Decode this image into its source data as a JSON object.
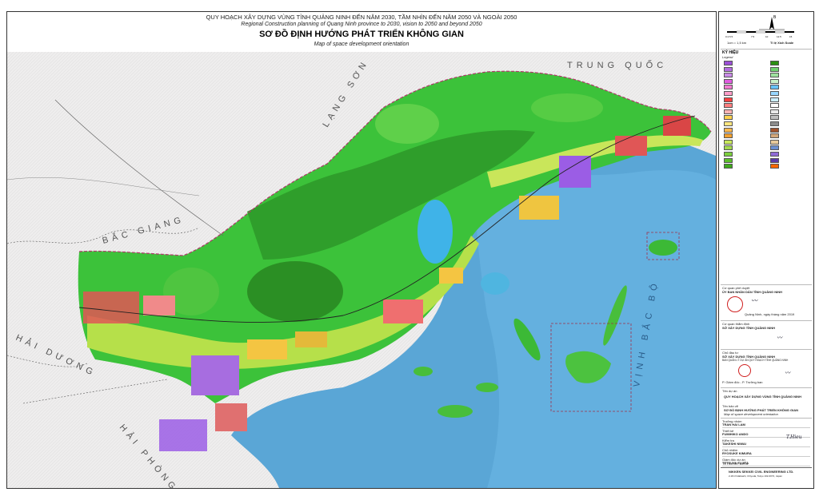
{
  "title": {
    "vn_line1": "QUY HOẠCH XÂY DỰNG VÙNG TỈNH QUẢNG NINH ĐẾN NĂM 2030, TẦM NHÌN ĐẾN NĂM 2050 VÀ NGOÀI 2050",
    "en_line1": "Regional Construction planning of Quang Ninh province to 2030, vision to 2050 and beyond 2050",
    "vn_main": "SƠ ĐỒ ĐỊNH HƯỚNG PHÁT TRIỂN KHÔNG GIAN",
    "en_main": "Map of space development orientation"
  },
  "map_labels": {
    "lang_son": "LẠNG SƠN",
    "trung_quoc": "TRUNG QUỐC",
    "bac_giang": "BẮC GIANG",
    "hai_duong": "HẢI DƯƠNG",
    "hai_phong": "HẢI PHÒNG",
    "vinh_bac_bo": "VỊNH BẮC BỘ"
  },
  "scale": {
    "ticks": [
      "0 2.5 5",
      "7.5",
      "10",
      "12.5",
      "15"
    ],
    "unit": "1cm = 1,5 km",
    "scale_text": "Tỉ lệ Xích Scale"
  },
  "legend": {
    "title_vn": "KÝ HIỆU",
    "title_en": "Legend",
    "colors": [
      "#9b4fd6",
      "#b46ce0",
      "#c98ae7",
      "#e05de0",
      "#f07bd0",
      "#ff9ec9",
      "#ff4040",
      "#ff7f7f",
      "#ffb3b3",
      "#ffd24d",
      "#ffe680",
      "#ffb84d",
      "#f0a030",
      "#c8e85c",
      "#a4d850",
      "#7ccf3e",
      "#5cbf2a",
      "#3fa81c",
      "#2b8f12",
      "#70d070",
      "#9fe09f",
      "#c8f0c8",
      "#66c2ff",
      "#99d6ff",
      "#cceeff",
      "#ffffff",
      "#e8e8e8",
      "#bdbdbd",
      "#8c8c8c",
      "#a0522d",
      "#d2a679",
      "#e6c99a",
      "#6a8fd0",
      "#8f6bd6",
      "#5a3aa8",
      "#ff6600"
    ]
  },
  "approval": {
    "head1": "Cơ quan phê duyệt",
    "org1": "ỦY BAN NHÂN DÂN TỈNH QUẢNG NINH",
    "date1": "Quảng Ninh, ngày   tháng   năm 2019",
    "head2": "Cơ quan thẩm định",
    "org2": "SỞ XÂY DỰNG TỈNH QUẢNG NINH",
    "head3": "Chủ đầu tư",
    "org3": "SỞ XÂY DỰNG TỈNH QUẢNG NINH",
    "sub3": "BAN QUẢN LÝ DỰ ÁN QUY HOẠCH TỈNH QUẢNG NINH",
    "role3": "P. Giám đốc - P. Trưởng ban",
    "head4": "Tên dự án",
    "project": "QUY HOẠCH XÂY DỰNG VÙNG TỈNH QUẢNG NINH",
    "head5": "Tên bản vẽ",
    "drawing": "SƠ ĐỒ ĐỊNH HƯỚNG PHÁT TRIỂN KHÔNG GIAN",
    "drawing_en": "Map of space development orientation",
    "sig_text": "T.Hieu"
  },
  "staff": [
    {
      "role": "Trưởng nhóm",
      "name": "TRAN HAI LAM"
    },
    {
      "role": "Thiết kế",
      "name": "FUMIHIKO ANDO"
    },
    {
      "role": "Kiểm tra",
      "name": "TAKESHI NIWAI"
    },
    {
      "role": "Chủ nhiệm",
      "name": "RYOSUKE KIMURA"
    },
    {
      "role": "Giám đốc dự án",
      "name": "TETSUYA FUJITA"
    }
  ],
  "company": {
    "name": "NIKKEN SEKKEI CIVIL ENGINEERING LTD.",
    "addr": "2-18-3 Iidabashi, Chiyoda, Tokyo 102-0072, Japan",
    "sign": "TETSUYA FUJITA"
  }
}
